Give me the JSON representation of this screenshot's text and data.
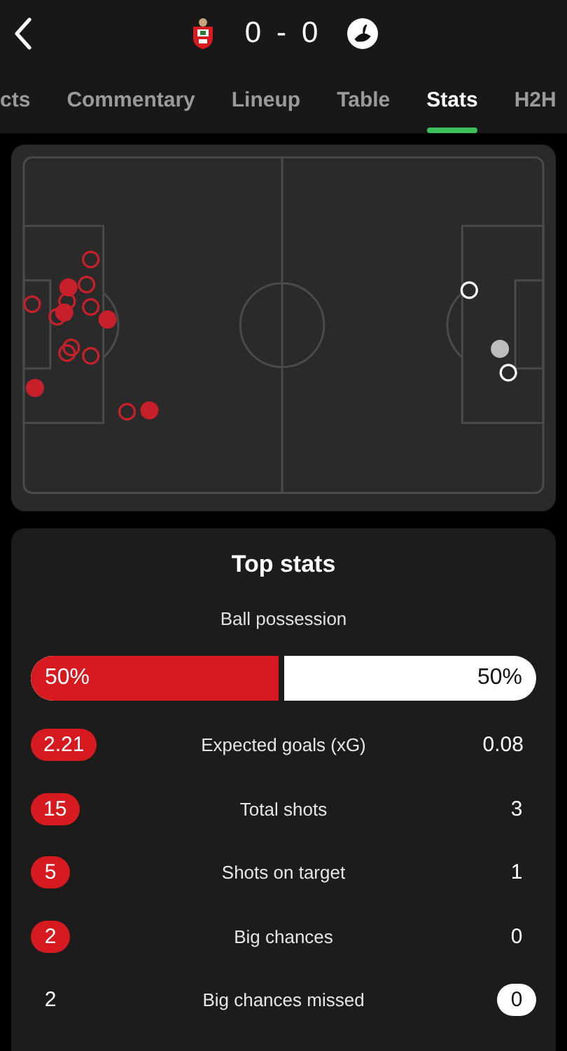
{
  "header": {
    "home_score": "0",
    "separator": "-",
    "away_score": "0"
  },
  "tabs": [
    {
      "label": "cts",
      "selected": false
    },
    {
      "label": "Commentary",
      "selected": false
    },
    {
      "label": "Lineup",
      "selected": false
    },
    {
      "label": "Table",
      "selected": false
    },
    {
      "label": "Stats",
      "selected": true
    },
    {
      "label": "H2H",
      "selected": false
    }
  ],
  "top_stats": {
    "title": "Top stats",
    "possession": {
      "label": "Ball possession",
      "home": "50%",
      "away": "50%",
      "level": 0.5
    },
    "rows": [
      {
        "home": "2.21",
        "label": "Expected goals (xG)",
        "away": "0.08",
        "home_leads": true,
        "away_leads": false
      },
      {
        "home": "15",
        "label": "Total shots",
        "away": "3",
        "home_leads": true,
        "away_leads": false
      },
      {
        "home": "5",
        "label": "Shots on target",
        "away": "1",
        "home_leads": true,
        "away_leads": false
      },
      {
        "home": "2",
        "label": "Big chances",
        "away": "0",
        "home_leads": true,
        "away_leads": false
      },
      {
        "home": "2",
        "label": "Big chances missed",
        "away": "0",
        "home_leads": false,
        "away_leads": true
      }
    ]
  }
}
